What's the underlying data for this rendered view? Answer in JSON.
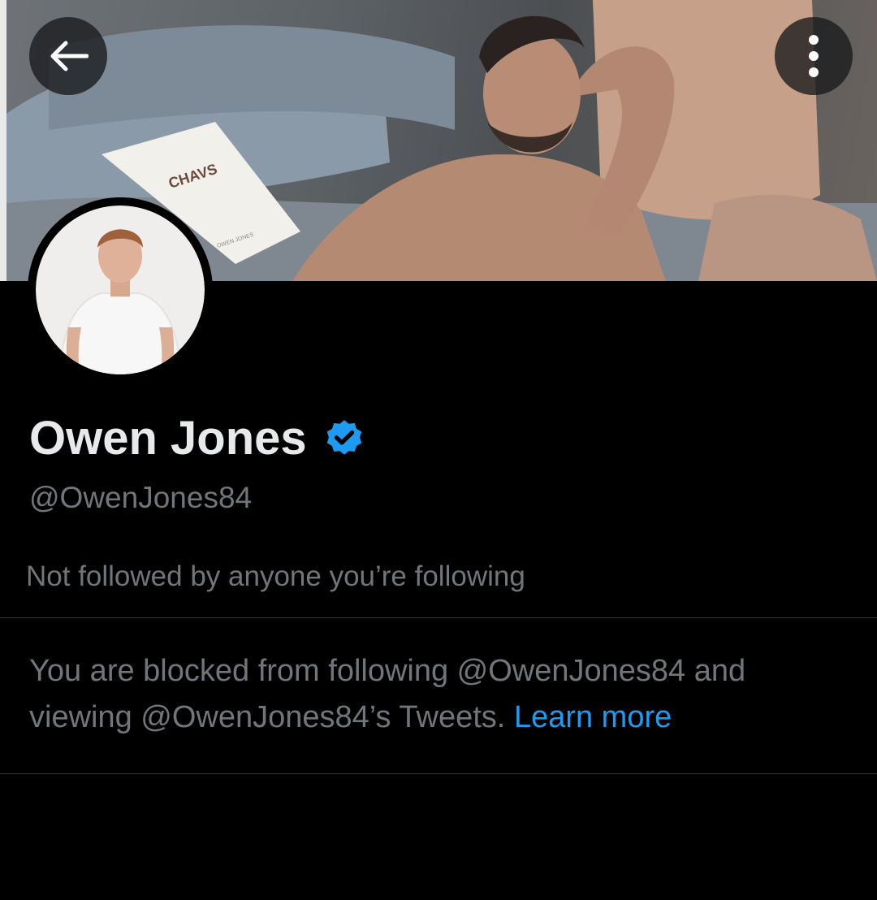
{
  "header": {
    "back_icon": "arrow-left-icon",
    "more_icon": "more-vertical-icon"
  },
  "banner": {
    "book_title": "CHAVS",
    "book_author": "OWEN JONES"
  },
  "profile": {
    "display_name": "Owen Jones",
    "verified_icon": "verified-badge-icon",
    "verified_color": "#1d9bf0",
    "handle": "@OwenJones84",
    "followed_by_text": "Not followed by anyone you’re following"
  },
  "blocked": {
    "message": "You are blocked from following @OwenJones84 and viewing @OwenJones84’s Tweets.",
    "link_label": "Learn more",
    "link_color": "#1d9bf0"
  },
  "theme": {
    "background": "#000000",
    "primary_text": "#e7e9ea",
    "secondary_text": "#71767b",
    "divider": "#2f3336"
  }
}
